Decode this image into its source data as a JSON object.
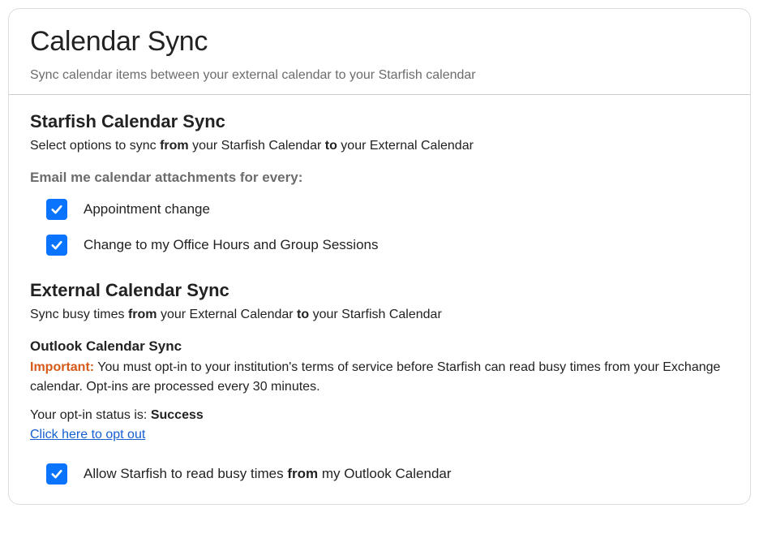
{
  "header": {
    "title": "Calendar Sync",
    "subtitle": "Sync calendar items between your external calendar to your Starfish calendar"
  },
  "starfish": {
    "title": "Starfish Calendar Sync",
    "desc_pre": "Select options to sync ",
    "desc_from": "from",
    "desc_mid": " your Starfish Calendar ",
    "desc_to": "to",
    "desc_post": " your External Calendar",
    "email_head": "Email me calendar attachments for every:",
    "option1": "Appointment change",
    "option2": "Change to my Office Hours and Group Sessions"
  },
  "external": {
    "title": "External Calendar Sync",
    "desc_pre": "Sync busy times ",
    "desc_from": "from",
    "desc_mid": " your External Calendar ",
    "desc_to": "to",
    "desc_post": " your Starfish Calendar"
  },
  "outlook": {
    "title": "Outlook Calendar Sync",
    "important_label": "Important:",
    "important_text": " You must opt-in to your institution's terms of service before Starfish can read busy times from your Exchange calendar. Opt-ins are processed every 30 minutes.",
    "status_pre": "Your opt-in status is: ",
    "status_value": "Success",
    "optout_link": "Click here to opt out",
    "allow_pre": "Allow Starfish to read busy times ",
    "allow_from": "from",
    "allow_post": " my Outlook Calendar"
  }
}
